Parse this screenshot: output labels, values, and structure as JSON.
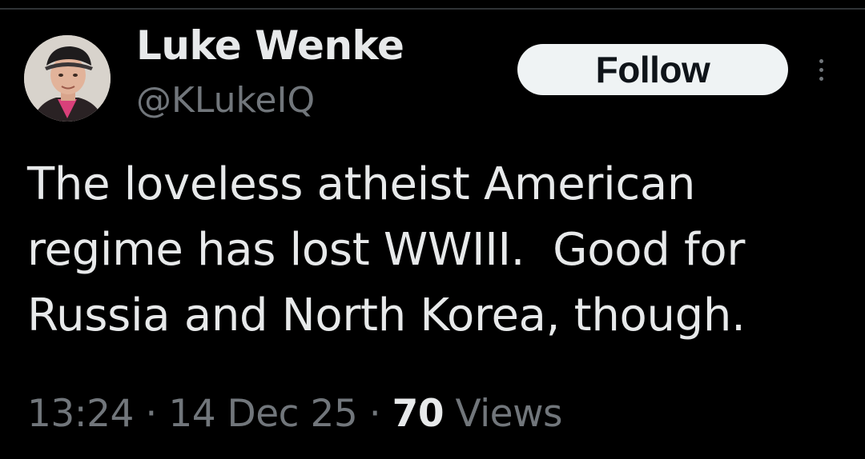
{
  "colors": {
    "background": "#000000",
    "primary_text": "#e7e9ea",
    "secondary_text": "#71767b",
    "follow_button_bg": "#eff3f4",
    "follow_button_text": "#0f1419"
  },
  "author": {
    "display_name": "Luke Wenke",
    "handle": "@KLukeIQ",
    "avatar_icon": "profile-photo"
  },
  "actions": {
    "follow_label": "Follow",
    "more_icon": "vertical-ellipsis-icon"
  },
  "tweet": {
    "text": "The loveless atheist American\nregime has lost WWIII.  Good for\nRussia and North Korea, though."
  },
  "meta": {
    "time": "13:24",
    "separator": "·",
    "date": "14 Dec 25",
    "views_count": "70",
    "views_label": "Views"
  }
}
